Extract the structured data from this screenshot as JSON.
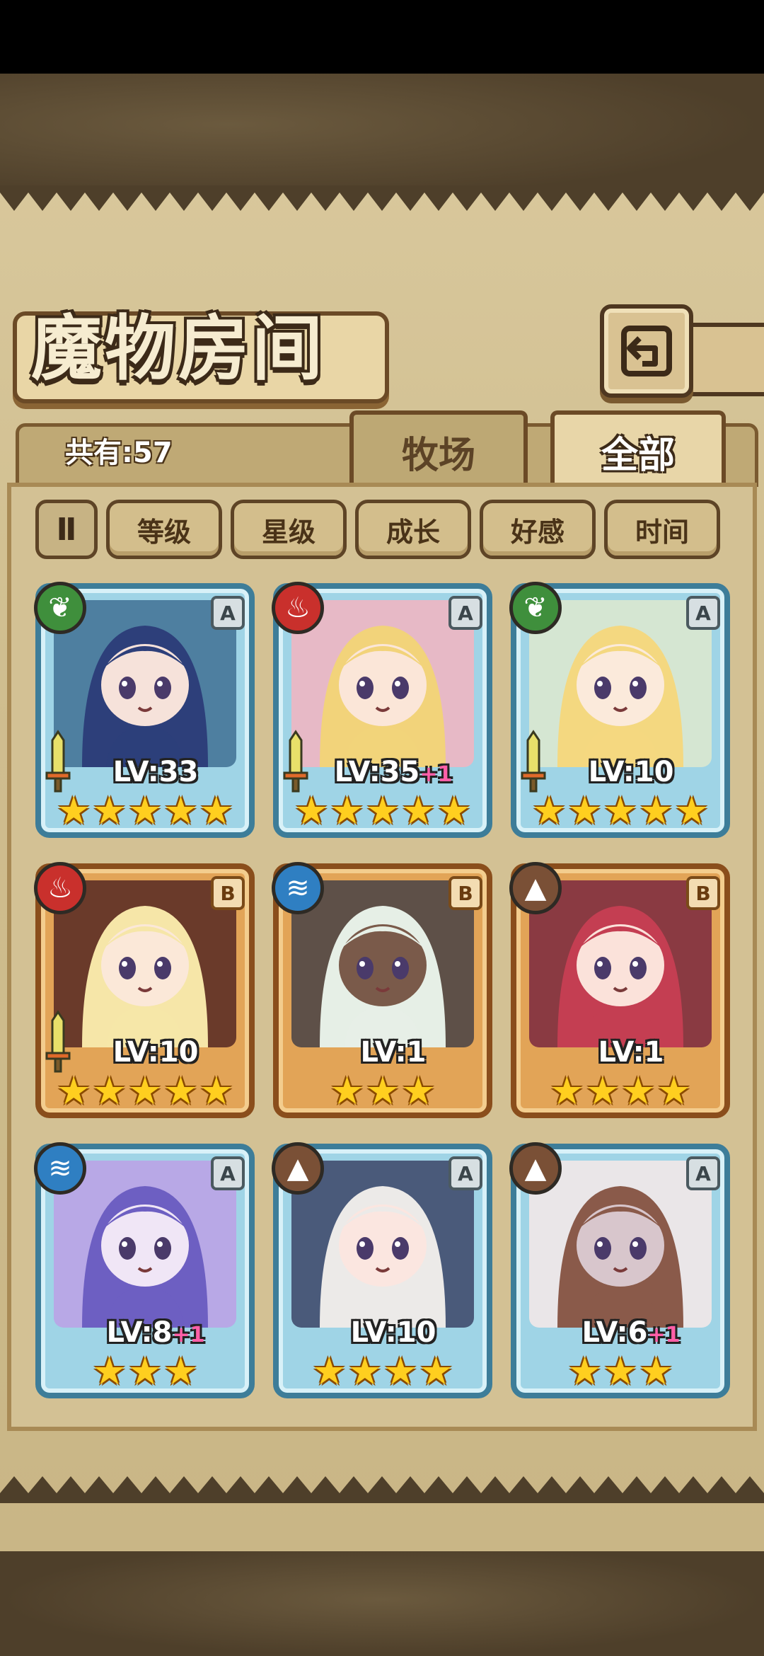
{
  "header": {
    "title": "魔物房间",
    "back_icon": "back-arrow-icon"
  },
  "count": {
    "label": "共有:57"
  },
  "tabs": [
    {
      "label": "牧场",
      "active": false
    },
    {
      "label": "全部",
      "active": true
    }
  ],
  "sort": {
    "toggle_label": "Ⅱ",
    "buttons": [
      "等级",
      "星级",
      "成长",
      "好感",
      "时间"
    ]
  },
  "monsters": [
    {
      "rank": "A",
      "element": "plant",
      "element_icon": "leaf-icon",
      "level": "LV:33",
      "plus": "",
      "stars": 5,
      "equipped": true,
      "hair": "#2d3f7a",
      "skin": "#f6e2da",
      "bg": "#4e7fa0"
    },
    {
      "rank": "A",
      "element": "fire",
      "element_icon": "flame-icon",
      "level": "LV:35",
      "plus": "+1",
      "stars": 5,
      "equipped": true,
      "hair": "#f2d37a",
      "skin": "#fbe6d8",
      "bg": "#e7b9c6"
    },
    {
      "rank": "A",
      "element": "plant",
      "element_icon": "leaf-icon",
      "level": "LV:10",
      "plus": "",
      "stars": 5,
      "equipped": true,
      "hair": "#f4d880",
      "skin": "#fbeadb",
      "bg": "#d5e6d2"
    },
    {
      "rank": "B",
      "element": "fire",
      "element_icon": "flame-icon",
      "level": "LV:10",
      "plus": "",
      "stars": 5,
      "equipped": true,
      "hair": "#f6e6a8",
      "skin": "#fbe8d8",
      "bg": "#6a3a2a"
    },
    {
      "rank": "B",
      "element": "water",
      "element_icon": "water-icon",
      "level": "LV:1",
      "plus": "",
      "stars": 3,
      "equipped": false,
      "hair": "#e6efe6",
      "skin": "#7a5a4a",
      "bg": "#5e5048"
    },
    {
      "rank": "B",
      "element": "earth",
      "element_icon": "mountain-icon",
      "level": "LV:1",
      "plus": "",
      "stars": 4,
      "equipped": false,
      "hair": "#c43e52",
      "skin": "#fbe2da",
      "bg": "#8a3a42"
    },
    {
      "rank": "A",
      "element": "water",
      "element_icon": "water-icon",
      "level": "LV:8",
      "plus": "+1",
      "stars": 3,
      "equipped": false,
      "hair": "#6d5fc2",
      "skin": "#f0e6f6",
      "bg": "#b8a8e6"
    },
    {
      "rank": "A",
      "element": "earth",
      "element_icon": "mountain-icon",
      "level": "LV:10",
      "plus": "",
      "stars": 4,
      "equipped": false,
      "hair": "#eceae8",
      "skin": "#fbe6e0",
      "bg": "#4a5a7a"
    },
    {
      "rank": "A",
      "element": "earth",
      "element_icon": "mountain-icon",
      "level": "LV:6",
      "plus": "+1",
      "stars": 3,
      "equipped": false,
      "hair": "#8a5a4a",
      "skin": "#d8c6cc",
      "bg": "#eae6e8"
    }
  ]
}
